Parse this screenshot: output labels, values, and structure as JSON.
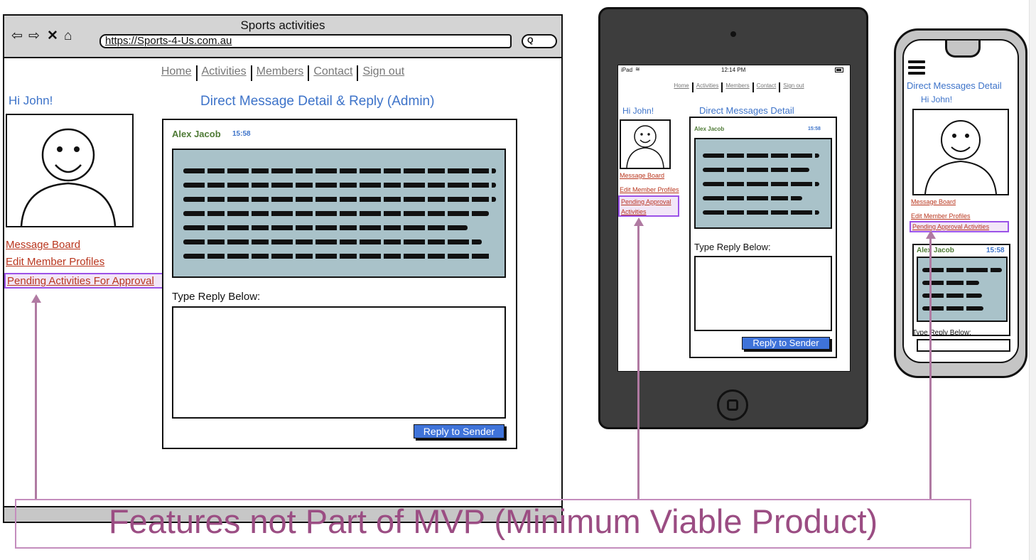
{
  "desktop": {
    "window_title": "Sports activities",
    "url": "https://Sports-4-Us.com.au",
    "search_button": "Q",
    "nav": [
      "Home",
      "Activities",
      "Members",
      "Contact",
      "Sign out"
    ],
    "greeting": "Hi John!",
    "page_title": "Direct Message Detail & Reply (Admin)",
    "sidebar_links": [
      "Message Board",
      "Edit Member Profiles",
      "Pending Activities For Approval"
    ],
    "message": {
      "sender": "Alex Jacob",
      "time": "15:58"
    },
    "reply_label": "Type Reply Below:",
    "reply_button": "Reply to Sender"
  },
  "tablet": {
    "status_carrier": "iPad",
    "status_time": "12:14 PM",
    "nav": [
      "Home",
      "Activities",
      "Members",
      "Contact",
      "Sign out"
    ],
    "greeting": "Hi John!",
    "page_title": "Direct Messages Detail",
    "sidebar_links": [
      "Message Board",
      "Edit Member Profiles"
    ],
    "pending_link_line1": "Pending Approval",
    "pending_link_line2": "Activities",
    "message": {
      "sender": "Alex Jacob",
      "time": "15:58"
    },
    "reply_label": "Type Reply Below:",
    "reply_button": "Reply to Sender"
  },
  "phone": {
    "page_title": "Direct Messages Detail",
    "greeting": "Hi John!",
    "sidebar_links": [
      "Message Board",
      "Edit Member Profiles",
      "Pending Approval Activities"
    ],
    "message": {
      "sender": "Alex Jacob",
      "time": "15:58"
    },
    "reply_label": "Type Reply Below:"
  },
  "annotation": "Features not Part of MVP (Minimum Viable Product)",
  "colors": {
    "link_red": "#b9361e",
    "title_blue": "#3d73c9",
    "highlight_purple": "#9b52e8",
    "annotation_mauve": "#9b4d83",
    "message_bg": "#a9c2c9",
    "button_blue": "#3f73d9"
  }
}
